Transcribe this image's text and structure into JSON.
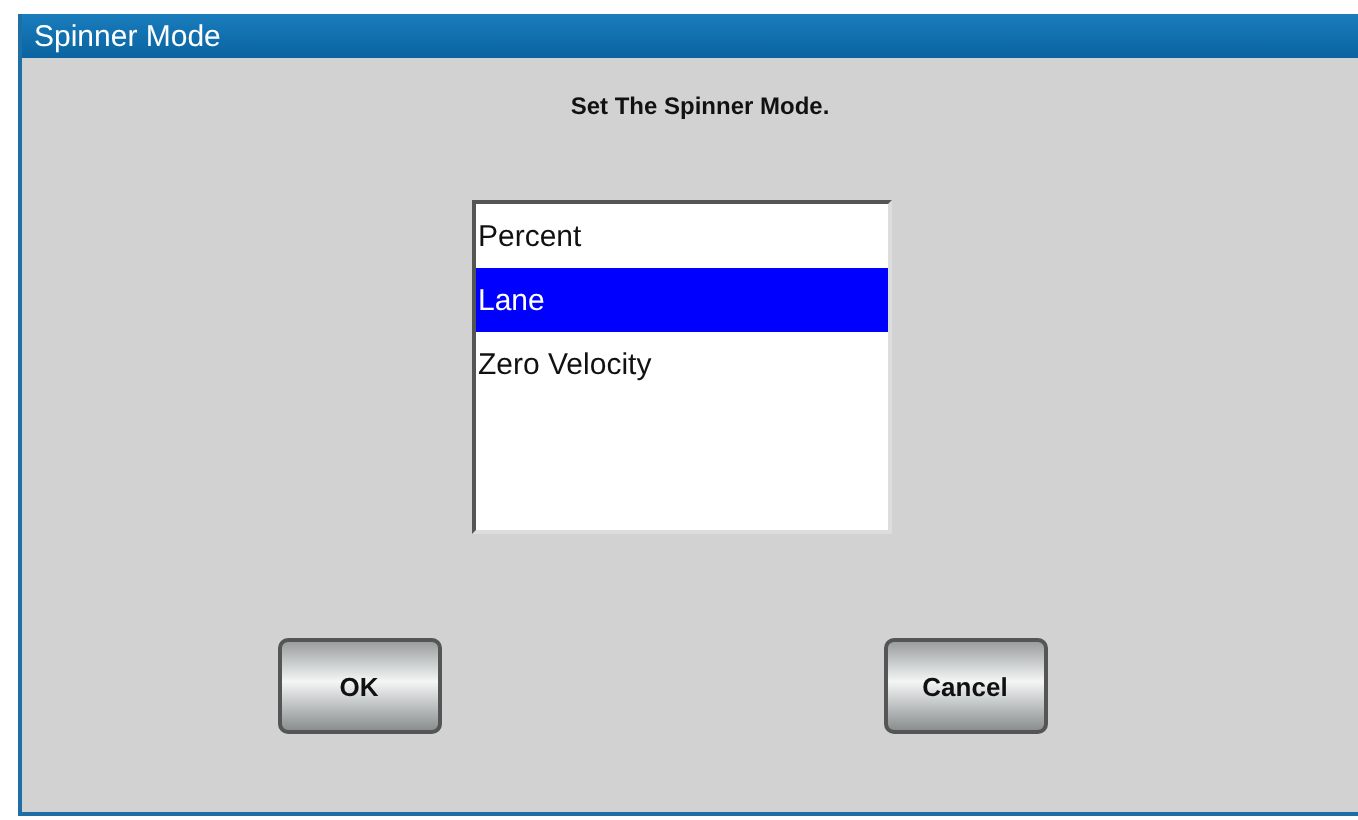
{
  "window": {
    "title": "Spinner Mode"
  },
  "prompt": "Set The Spinner Mode.",
  "list": {
    "items": [
      {
        "label": "Percent",
        "selected": false
      },
      {
        "label": "Lane",
        "selected": true
      },
      {
        "label": "Zero Velocity",
        "selected": false
      }
    ]
  },
  "buttons": [
    {
      "label": "OK"
    },
    {
      "label": "Cancel"
    }
  ]
}
